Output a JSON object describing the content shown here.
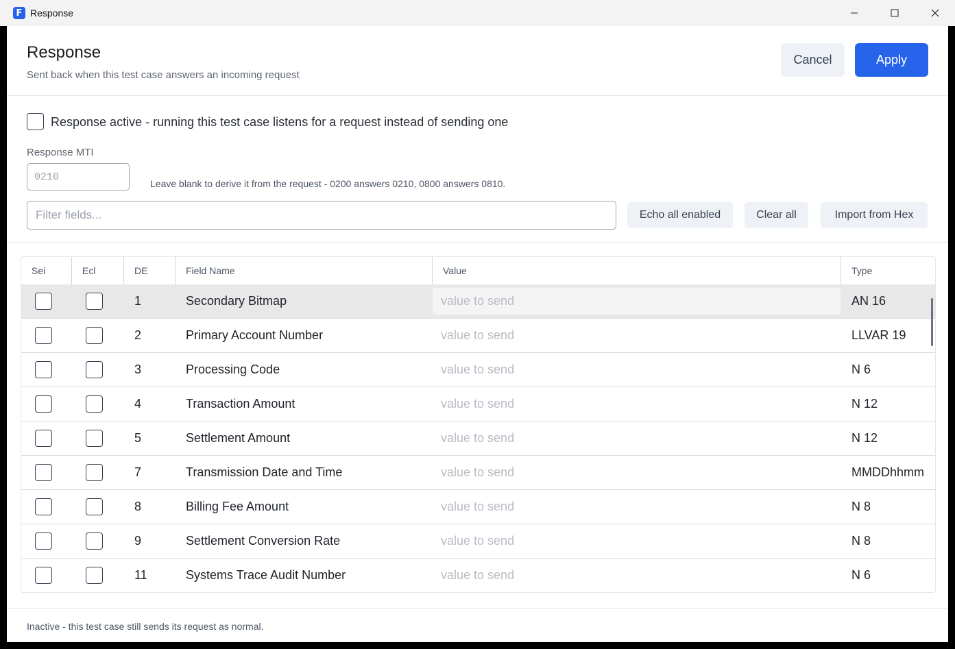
{
  "window": {
    "title": "Response",
    "app_icon_letter": "F",
    "controls": [
      "minimize-icon",
      "maximize-icon",
      "close-icon"
    ]
  },
  "header": {
    "title": "Response",
    "subtitle": "Sent back when this test case answers an incoming request",
    "cancel_label": "Cancel",
    "apply_label": "Apply",
    "apply_color": "#2563eb"
  },
  "response_active": {
    "checked": false,
    "label": "Response active - running this test case listens for a request instead of sending one"
  },
  "mti": {
    "label": "Response MTI",
    "value": "",
    "placeholder": "0210",
    "hint": "Leave blank to derive it from the request - 0200 answers 0210, 0800 answers 0810."
  },
  "filter": {
    "value": "",
    "placeholder": "Filter fields..."
  },
  "toolbar": {
    "echo_label": "Echo all enabled",
    "clear_label": "Clear all",
    "import_label": "Import from Hex"
  },
  "table": {
    "columns": [
      "Sei",
      "Ecl",
      "DE",
      "Field Name",
      "Value",
      "Type"
    ],
    "value_placeholder": "value to send",
    "rows": [
      {
        "send": false,
        "echo": false,
        "de": "1",
        "name": "Secondary Bitmap",
        "value": "",
        "type": "AN 16",
        "selected": true
      },
      {
        "send": false,
        "echo": false,
        "de": "2",
        "name": "Primary Account Number",
        "value": "",
        "type": "LLVAR 19"
      },
      {
        "send": false,
        "echo": false,
        "de": "3",
        "name": "Processing Code",
        "value": "",
        "type": "N 6"
      },
      {
        "send": false,
        "echo": false,
        "de": "4",
        "name": "Transaction Amount",
        "value": "",
        "type": "N 12"
      },
      {
        "send": false,
        "echo": false,
        "de": "5",
        "name": "Settlement Amount",
        "value": "",
        "type": "N 12"
      },
      {
        "send": false,
        "echo": false,
        "de": "7",
        "name": "Transmission Date and Time",
        "value": "",
        "type": "MMDDhhmm"
      },
      {
        "send": false,
        "echo": false,
        "de": "8",
        "name": "Billing Fee Amount",
        "value": "",
        "type": "N 8"
      },
      {
        "send": false,
        "echo": false,
        "de": "9",
        "name": "Settlement Conversion Rate",
        "value": "",
        "type": "N 8"
      },
      {
        "send": false,
        "echo": false,
        "de": "11",
        "name": "Systems Trace Audit Number",
        "value": "",
        "type": "N 6"
      }
    ]
  },
  "footer": {
    "status": "Inactive - this test case still sends its request as normal."
  }
}
